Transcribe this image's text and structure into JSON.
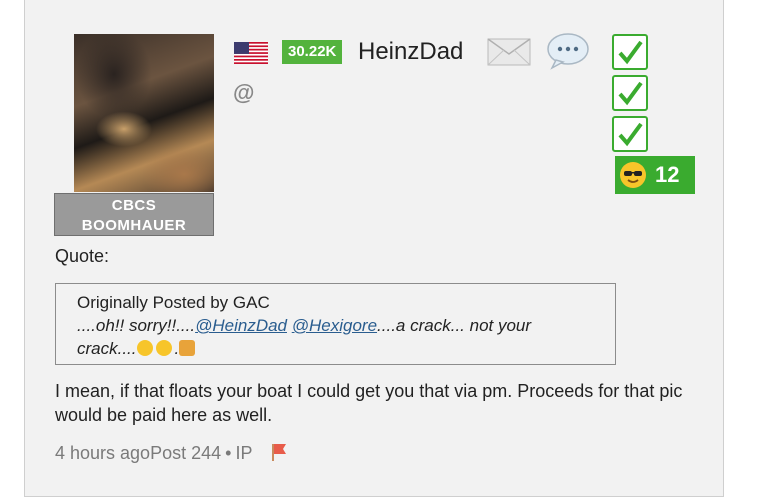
{
  "user": {
    "rank_line1": "CBCS",
    "rank_line2": "BOOMHAUER",
    "points": "30.22K",
    "username": "HeinzDad",
    "at_symbol": "@",
    "reaction_count": "12"
  },
  "quote": {
    "label": "Quote:",
    "author_line": "Originally Posted by GAC",
    "text_before": "....oh!! sorry!!....",
    "mention1": "@HeinzDad",
    "mention2": "@Hexigore",
    "text_after": "....a crack... not your crack....",
    "text_end": "."
  },
  "post": {
    "body": "I mean, if that floats your boat I could get you that via pm. Proceeds for that pic would be paid here as well."
  },
  "footer": {
    "time": "4 hours ago",
    "post_number": "Post 244",
    "separator": "•",
    "ip_label": "IP"
  },
  "colors": {
    "accent_green": "#3aab2f",
    "rank_grey": "#9a9a9a",
    "link_blue": "#2a5d8f"
  },
  "icons": [
    "us-flag-icon",
    "envelope-icon",
    "speech-bubble-icon",
    "checkmark-icon",
    "sunglasses-emoji-icon",
    "grin-emoji-icon",
    "wink-emoji-icon",
    "beer-emoji-icon",
    "report-flag-icon"
  ]
}
